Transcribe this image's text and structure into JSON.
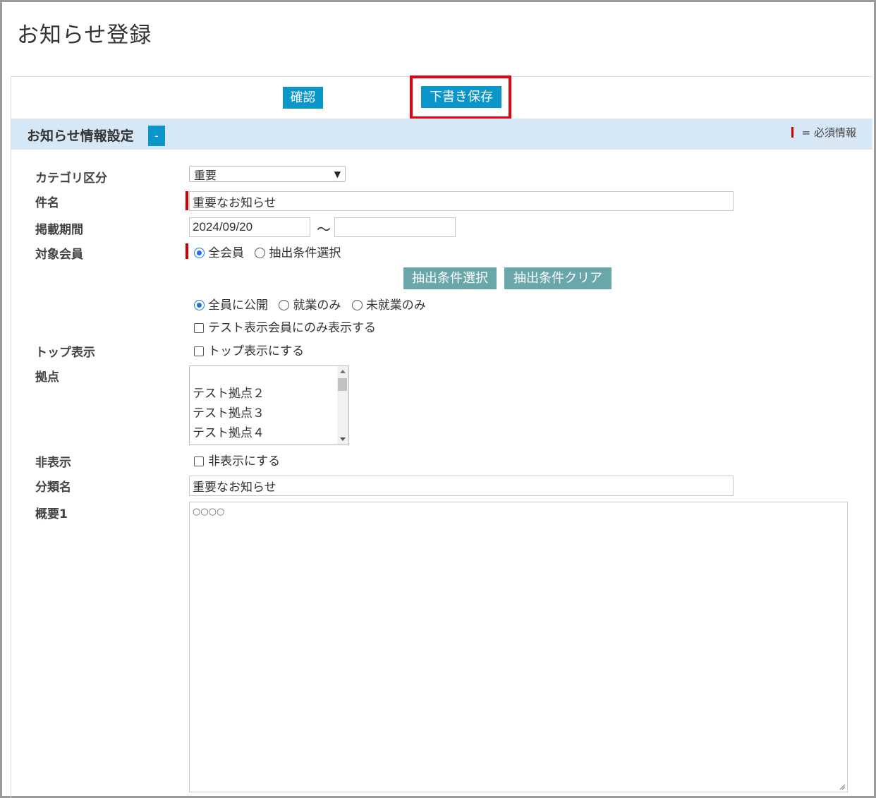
{
  "page": {
    "title": "お知らせ登録"
  },
  "toolbar": {
    "confirm_label": "確認",
    "draft_label": "下書き保存"
  },
  "section": {
    "title": "お知らせ情報設定",
    "collapse_label": "-",
    "required_legend": "= 必須情報"
  },
  "form": {
    "category": {
      "label": "カテゴリ区分",
      "value": "重要"
    },
    "subject": {
      "label": "件名",
      "value": "重要なお知らせ"
    },
    "period": {
      "label": "掲載期間",
      "start": "2024/09/20",
      "separator": "〜",
      "end": ""
    },
    "target": {
      "label": "対象会員",
      "options": [
        "全会員",
        "抽出条件選択"
      ],
      "selected": "全会員",
      "select_button": "抽出条件選択",
      "clear_button": "抽出条件クリア",
      "publish_options": [
        "全員に公開",
        "就業のみ",
        "未就業のみ"
      ],
      "publish_selected": "全員に公開",
      "test_only_label": "テスト表示会員にのみ表示する"
    },
    "top_display": {
      "label": "トップ表示",
      "checkbox_label": "トップ表示にする"
    },
    "base": {
      "label": "拠点",
      "items": [
        "テスト拠点２",
        "テスト拠点３",
        "テスト拠点４"
      ]
    },
    "hidden": {
      "label": "非表示",
      "checkbox_label": "非表示にする"
    },
    "classification": {
      "label": "分類名",
      "value": "重要なお知らせ"
    },
    "summary": {
      "label": "概要1",
      "value": "○○○○"
    }
  },
  "colors": {
    "accent": "#0b96c9",
    "teal": "#6aa7ab",
    "required": "#cc0000",
    "highlight": "#e60012",
    "section_bg": "#d6e7f5"
  }
}
